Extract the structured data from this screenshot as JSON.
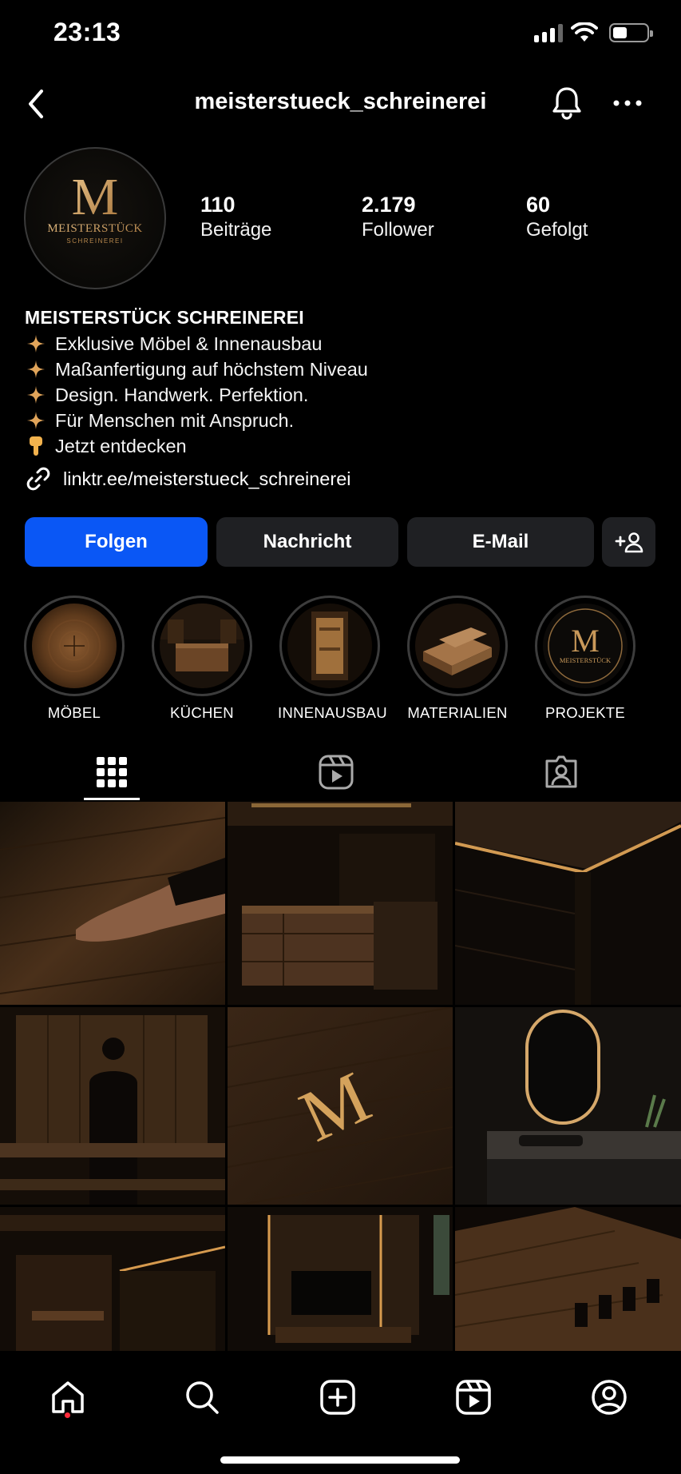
{
  "status_bar": {
    "time": "23:13"
  },
  "header": {
    "username": "meisterstueck_schreinerei"
  },
  "profile": {
    "avatar": {
      "monogram": "M",
      "brand": "MEISTERSTÜCK",
      "subtitle": "SCHREINEREI"
    },
    "stats": [
      {
        "value": "110",
        "label": "Beiträge"
      },
      {
        "value": "2.179",
        "label": "Follower"
      },
      {
        "value": "60",
        "label": "Gefolgt"
      }
    ],
    "bio": {
      "name": "MEISTERSTÜCK SCHREINEREI",
      "lines": [
        "Exklusive Möbel & Innenausbau",
        "Maßanfertigung auf höchstem Niveau",
        "Design. Handwerk. Perfektion.",
        "Für Menschen mit Anspruch.",
        "Jetzt entdecken"
      ],
      "link": "linktr.ee/meisterstueck_schreinerei"
    }
  },
  "actions": {
    "follow": "Folgen",
    "message": "Nachricht",
    "email": "E-Mail"
  },
  "highlights": [
    {
      "label": "MÖBEL"
    },
    {
      "label": "KÜCHEN"
    },
    {
      "label": "INNENAUSBAU"
    },
    {
      "label": "MATERIALIEN"
    },
    {
      "label": "PROJEKTE",
      "monogram": "M",
      "brand": "MEISTERSTÜCK"
    }
  ],
  "tabs": [
    "posts-grid-icon",
    "reels-icon",
    "tagged-icon"
  ],
  "grid_tile_overlay": {
    "monogram": "M"
  },
  "colors": {
    "accent": "#0a57f5",
    "background": "#000000",
    "gold": "#c9995a",
    "button": "#1f2023",
    "notification": "#ff2a3a"
  }
}
